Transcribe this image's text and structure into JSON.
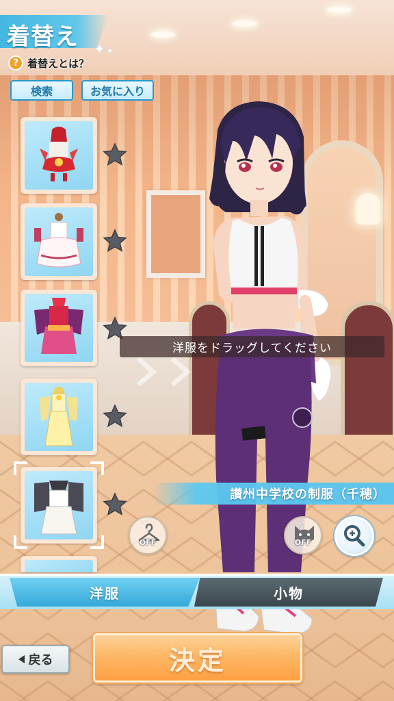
{
  "header": {
    "title": "着替え",
    "help_label": "着替えとは？",
    "help_icon": "question-icon"
  },
  "toolbar": {
    "search_label": "検索",
    "favorites_label": "お気に入り"
  },
  "outfit_list": {
    "items": [
      {
        "icon": "red-festival-outfit-icon",
        "favorite": false,
        "selected": false
      },
      {
        "icon": "white-pink-dress-outfit-icon",
        "favorite": false,
        "selected": false
      },
      {
        "icon": "kimono-outfit-icon",
        "favorite": false,
        "selected": false
      },
      {
        "icon": "yellow-dress-outfit-icon",
        "favorite": false,
        "selected": false
      },
      {
        "icon": "school-uniform-outfit-icon",
        "favorite": false,
        "selected": true
      }
    ]
  },
  "overlay": {
    "drag_hint": "洋服をドラッグしてください",
    "selected_outfit_name": "讃州中学校の制服（千穂）",
    "hanger_toggle_label": "OFF",
    "cat_toggle_label": "OFF"
  },
  "tabs": {
    "items": [
      {
        "label": "洋服",
        "active": true
      },
      {
        "label": "小物",
        "active": false
      }
    ]
  },
  "footer": {
    "back_label": "戻る",
    "confirm_label": "決定"
  },
  "colors": {
    "accent_blue": "#43b8e0",
    "confirm_orange": "#ff9e3d",
    "inactive_tab": "#3a464d"
  }
}
